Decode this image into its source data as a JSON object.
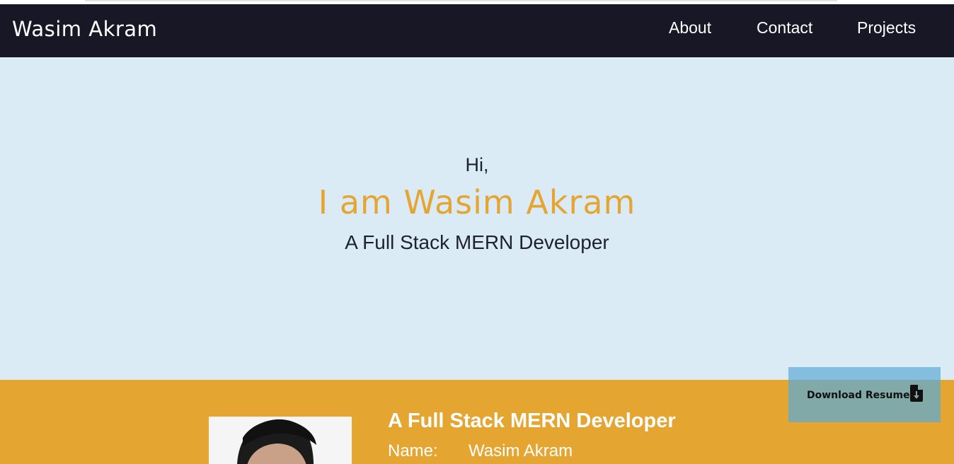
{
  "navbar": {
    "brand": "Wasim Akram",
    "links": [
      {
        "label": "About"
      },
      {
        "label": "Contact"
      },
      {
        "label": "Projects"
      }
    ]
  },
  "hero": {
    "greeting": "Hi,",
    "headline": "I am Wasim Akram",
    "role": "A Full Stack MERN Developer"
  },
  "about": {
    "title": "A Full Stack MERN Developer",
    "name_label": "Name:",
    "name_value": "Wasim Akram"
  },
  "download": {
    "label": "Download Resume",
    "icon": "file-download-icon"
  },
  "colors": {
    "navbar_bg": "#181726",
    "hero_bg": "#daebf6",
    "accent": "#e5a531",
    "button_bg": "#83bde0",
    "button_overlay": "#80a9a7"
  }
}
